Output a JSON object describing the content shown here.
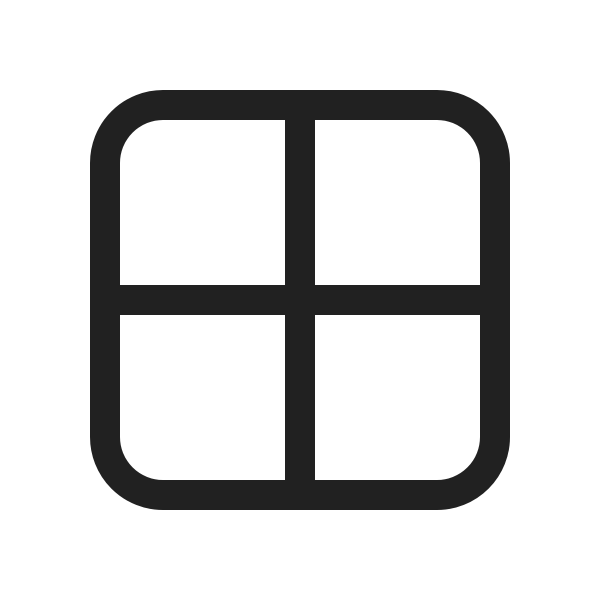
{
  "icon": {
    "name": "grid-four-squares-icon",
    "color": "#212121",
    "background": "#ffffff"
  }
}
